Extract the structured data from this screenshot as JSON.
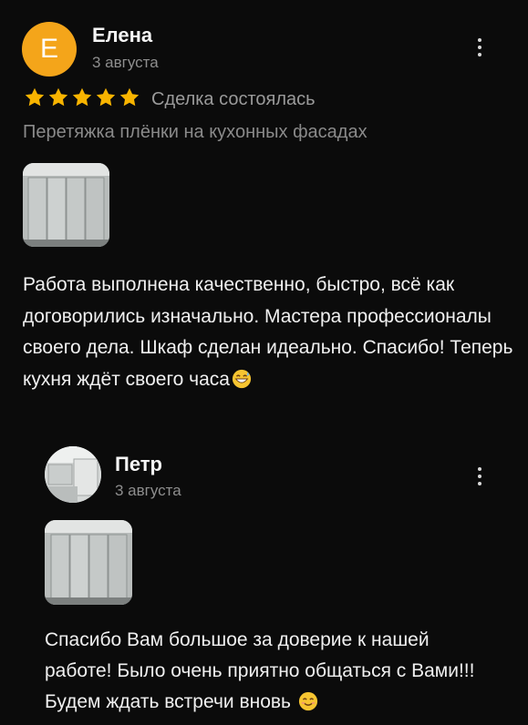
{
  "review": {
    "author_initial": "Е",
    "author_name": "Елена",
    "date": "3 августа",
    "rating": 5,
    "deal_status": "Сделка состоялась",
    "service": "Перетяжка плёнки на кухонных фасадах",
    "text": "Работа выполнена качественно, быстро, всё как договорились изначально. Мастера профессионалы своего дела. Шкаф сделан идеально. Спасибо! Теперь кухня ждёт своего часа",
    "text_emoji": "grinning-sweat-emoji",
    "photo_icon": "kitchen-cabinet-photo"
  },
  "reply": {
    "author_name": "Петр",
    "date": "3 августа",
    "text": "Спасибо Вам большое за доверие к нашей работе! Было очень приятно общаться с Вами!!! Будем ждать встречи вновь",
    "text_emoji": "smiling-blush-emoji",
    "photo_icon": "kitchen-cabinet-photo"
  },
  "colors": {
    "background": "#0b0b0b",
    "avatar": "#f4a51a",
    "star": "#f8b400",
    "secondary_text": "#8e8e8e"
  }
}
